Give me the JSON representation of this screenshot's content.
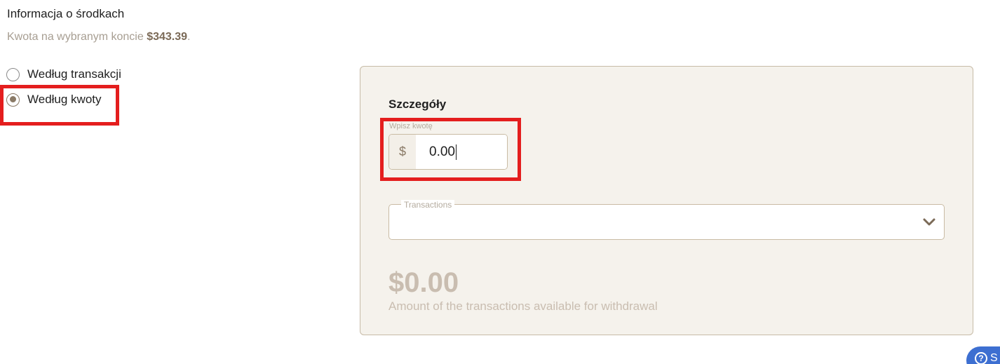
{
  "info": {
    "title": "Informacja o środkach",
    "balance_prefix": "Kwota na wybranym koncie ",
    "balance_amount": "$343.39",
    "balance_suffix": "."
  },
  "mode": {
    "options": [
      {
        "label": "Według transakcji",
        "checked": false
      },
      {
        "label": "Według kwoty",
        "checked": true
      }
    ]
  },
  "details": {
    "title": "Szczegóły",
    "amount_label": "Wpisz kwotę",
    "currency_symbol": "$",
    "amount_value": "0.00",
    "transactions_label": "Transactions",
    "transactions_value": "",
    "available_amount": "$0.00",
    "available_caption": "Amount of the transactions available for withdrawal"
  },
  "help": {
    "label": "S",
    "icon": "question-circle-icon"
  },
  "colors": {
    "accent": "#8a7a66",
    "panel_bg": "#f5f2ec",
    "highlight": "#e41e1e",
    "help_button": "#3d6fd1"
  }
}
